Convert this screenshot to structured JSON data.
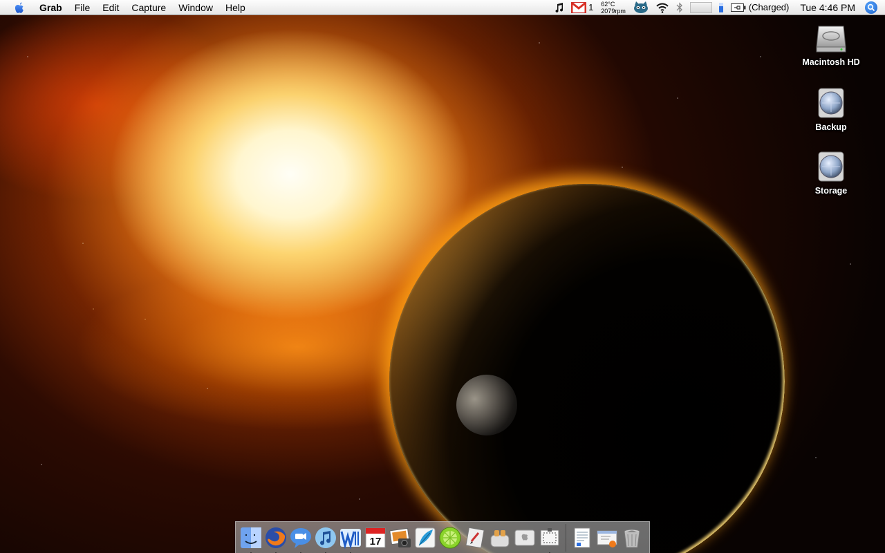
{
  "menubar": {
    "apple_icon": "apple-icon",
    "app_name": "Grab",
    "menus": [
      "File",
      "Edit",
      "Capture",
      "Window"
    ],
    "help": "Help",
    "extras": {
      "music_icon": "music-note-icon",
      "gmail_icon": "gmail-icon",
      "gmail_count": "1",
      "temperature": "62°C",
      "fan_speed": "2079rpm",
      "cat_icon": "cat-face-icon",
      "wifi_icon": "wifi-icon",
      "bluetooth_icon": "bluetooth-icon",
      "battery_status": "(Charged)",
      "clock": "Tue 4:46 PM",
      "spotlight_icon": "spotlight-icon"
    }
  },
  "desktop_icons": [
    {
      "label": "Macintosh HD",
      "icon": "hard-drive-icon"
    },
    {
      "label": "Backup",
      "icon": "disk-image-icon"
    },
    {
      "label": "Storage",
      "icon": "disk-image-icon"
    }
  ],
  "dock": {
    "apps": [
      {
        "name": "Finder",
        "icon": "finder-icon",
        "running": true
      },
      {
        "name": "Firefox",
        "icon": "firefox-icon",
        "running": true
      },
      {
        "name": "iChat",
        "icon": "ichat-icon",
        "running": true
      },
      {
        "name": "iTunes",
        "icon": "itunes-icon",
        "running": true
      },
      {
        "name": "Word",
        "icon": "word-icon",
        "running": true
      },
      {
        "name": "iCal",
        "icon": "ical-icon",
        "running": false,
        "date": "17"
      },
      {
        "name": "iPhoto",
        "icon": "iphoto-icon",
        "running": false
      },
      {
        "name": "Feather",
        "icon": "feather-icon",
        "running": false
      },
      {
        "name": "LimeWire",
        "icon": "limewire-icon",
        "running": false
      },
      {
        "name": "Script Editor",
        "icon": "script-editor-icon",
        "running": false
      },
      {
        "name": "Toaster",
        "icon": "toaster-icon",
        "running": false
      },
      {
        "name": "System Prefs",
        "icon": "apple-hardware-icon",
        "running": false
      },
      {
        "name": "Grab",
        "icon": "grab-icon",
        "running": true
      }
    ],
    "documents": [
      {
        "name": "Document",
        "icon": "document-icon"
      },
      {
        "name": "Downloads",
        "icon": "downloads-icon"
      },
      {
        "name": "Trash",
        "icon": "trash-icon"
      }
    ]
  },
  "colors": {
    "menubar_top": "#fdfdfd",
    "menubar_bottom": "#e6e6e6",
    "gmail_red": "#d93025",
    "spotlight_blue": "#1a5fc8"
  }
}
